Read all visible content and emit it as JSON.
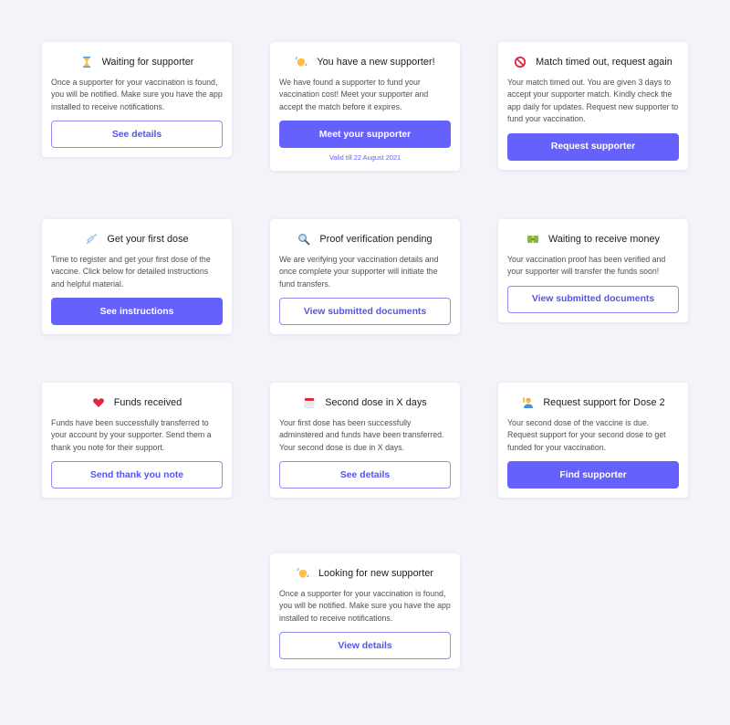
{
  "theme": {
    "accent": "#6461fc",
    "background": "#f3f3f9",
    "card_background": "#ffffff"
  },
  "cards": [
    {
      "icon": "hourglass-icon",
      "title": "Waiting for supporter",
      "body": "Once a supporter for your vaccination is found, you will be notified. Make sure you have the app installed to receive notifications.",
      "button": "See details",
      "button_style": "outline"
    },
    {
      "icon": "waving-hand-icon",
      "title": "You have a new supporter!",
      "body": "We have found a supporter to fund your vaccination cost! Meet your supporter and accept the match before it expires.",
      "button": "Meet your supporter",
      "button_style": "primary",
      "note": "Valid till 22 August 2021"
    },
    {
      "icon": "prohibited-icon",
      "title": "Match timed out, request again",
      "body": "Your match timed out. You are given 3 days to accept your supporter match. Kindly check the app daily for updates. Request new supporter to fund your vaccination.",
      "button": "Request supporter",
      "button_style": "primary"
    },
    {
      "icon": "syringe-icon",
      "title": "Get your first dose",
      "body": "Time to register and get your first dose of the vaccine. Click below for detailed instructions and helpful material.",
      "button": "See instructions",
      "button_style": "primary"
    },
    {
      "icon": "magnifier-icon",
      "title": "Proof verification pending",
      "body": "We are verifying your vaccination details and once complete your supporter will initiate the fund transfers.",
      "button": "View submitted documents",
      "button_style": "outline"
    },
    {
      "icon": "money-icon",
      "title": "Waiting to receive money",
      "body": "Your vaccination proof has been verified and your supporter will transfer the funds soon!",
      "button": "View submitted documents",
      "button_style": "outline"
    },
    {
      "icon": "heart-icon",
      "title": "Funds received",
      "body": "Funds have been successfully transferred to your account by your supporter. Send them a thank you note for their support.",
      "button": "Send thank you note",
      "button_style": "outline"
    },
    {
      "icon": "calendar-icon",
      "title": "Second dose in X days",
      "body": "Your first dose has been successfully adminstered and funds have been transferred. Your second dose is due in X days.",
      "button": "See details",
      "button_style": "outline"
    },
    {
      "icon": "person-raising-hand-icon",
      "title": "Request support for Dose 2",
      "body": "Your second dose of the vaccine is due. Request support for your second dose to get funded for your vaccination.",
      "button": "Find supporter",
      "button_style": "primary"
    },
    {
      "icon": "waving-hand-icon",
      "title": "Looking for new supporter",
      "body": "Once a supporter for your vaccination is found, you will be notified. Make sure you have the app installed to receive notifications.",
      "button": "View details",
      "button_style": "outline"
    }
  ]
}
